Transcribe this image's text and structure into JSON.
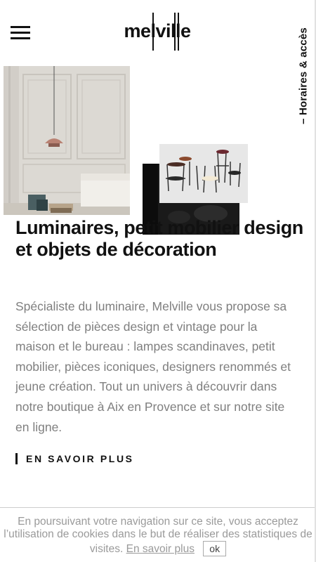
{
  "header": {
    "logo_text": "melville",
    "side_link_label": "– Horaires & accès"
  },
  "hero": {
    "images": [
      "interior-pendant-lamp-photo",
      "chairs-photo",
      "black-decor-photo"
    ]
  },
  "main": {
    "headline": "Luminaires, petit mobilier design et objets de décoration",
    "description": "Spécialiste du luminaire, Melville vous propose sa sélection de pièces design et vintage pour la maison et le bureau : lampes scandinaves, petit mobilier, pièces iconiques, designers renommés et jeune création. Tout un univers à découvrir dans notre boutique à Aix en Provence et sur notre site en ligne.",
    "cta_label": "EN SAVOIR PLUS"
  },
  "cookie": {
    "text": "En poursuivant votre navigation sur ce site, vous acceptez l’utilisation de cookies dans le but de réaliser des statistiques de visites.",
    "link_label": "En savoir plus",
    "ok_label": "ok"
  },
  "colors": {
    "text": "#111111",
    "body_text": "#7f7f7f",
    "cookie_text": "#9a9a9a"
  }
}
